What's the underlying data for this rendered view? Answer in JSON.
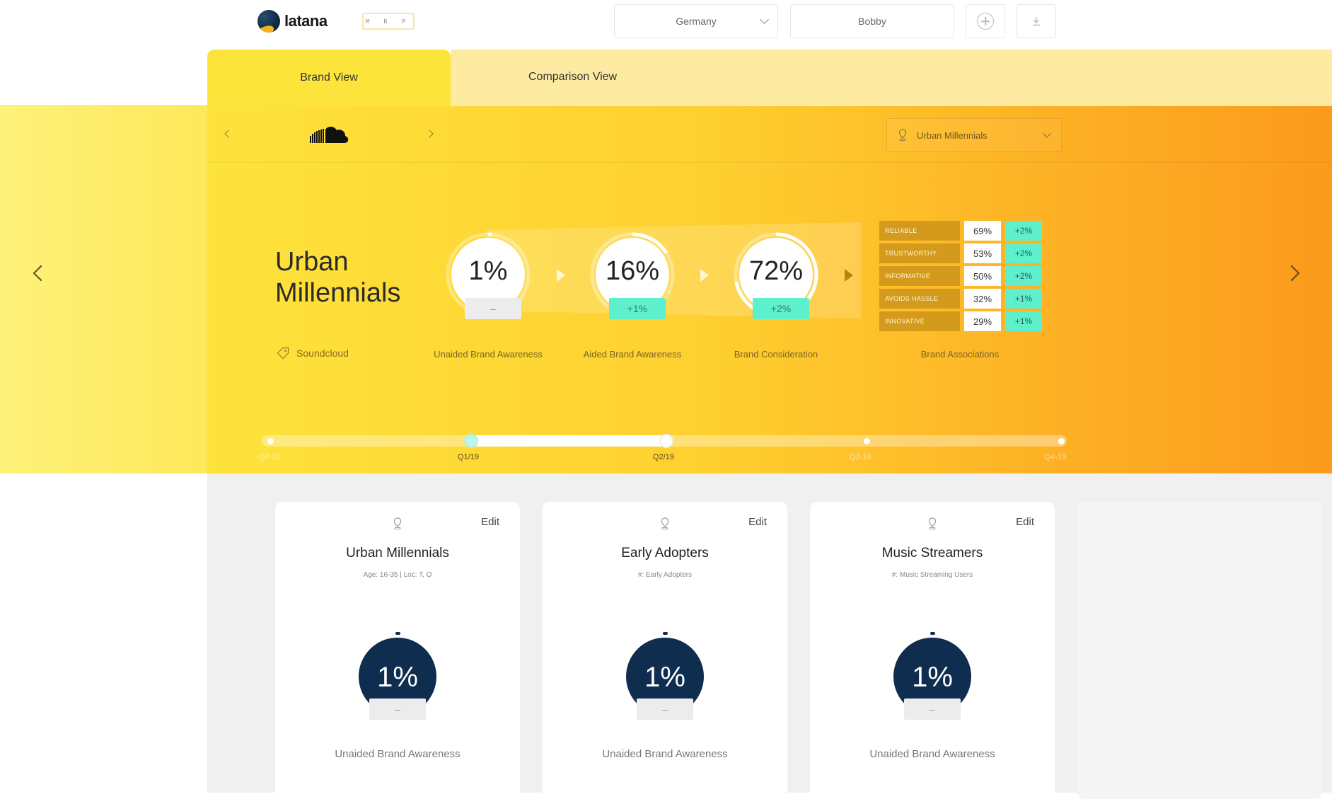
{
  "header": {
    "logo_text": "latana",
    "badge_text": "M R P",
    "country": "Germany",
    "user": "Bobby",
    "add_icon": "plus-circle-icon",
    "download_icon": "download-icon"
  },
  "tabs": [
    {
      "label": "Brand View",
      "active": true
    },
    {
      "label": "Comparison View",
      "active": false
    }
  ],
  "hero": {
    "brand_logo_icon": "soundcloud-logo",
    "segment_select": "Urban Millennials",
    "segment_title": "Urban Millennials",
    "brand_tag": "Soundcloud",
    "metrics": [
      {
        "value": "1%",
        "delta": "–",
        "label": "Unaided Brand Awareness",
        "fill": 0.01
      },
      {
        "value": "16%",
        "delta": "+1%",
        "label": "Aided Brand Awareness",
        "fill": 0.16
      },
      {
        "value": "72%",
        "delta": "+2%",
        "label": "Brand Consideration",
        "fill": 0.72
      }
    ],
    "associations_label": "Brand Associations",
    "associations": [
      {
        "label": "RELIABLE",
        "value": "69%",
        "delta": "+2%"
      },
      {
        "label": "TRUSTWORTHY",
        "value": "53%",
        "delta": "+2%"
      },
      {
        "label": "INFORMATIVE",
        "value": "50%",
        "delta": "+2%"
      },
      {
        "label": "AVOIDS HASSLE",
        "value": "32%",
        "delta": "+1%"
      },
      {
        "label": "INNOVATIVE",
        "value": "29%",
        "delta": "+1%"
      }
    ],
    "timeline": [
      {
        "label": "Q4-18",
        "selected": false
      },
      {
        "label": "Q1/19",
        "selected": true
      },
      {
        "label": "Q2/19",
        "selected": true
      },
      {
        "label": "Q3-19",
        "selected": false
      },
      {
        "label": "Q4-19",
        "selected": false
      }
    ]
  },
  "cards": [
    {
      "title": "Urban Millennials",
      "subtitle": "Age: 16-35 | Loc: T, O",
      "edit": "Edit",
      "value": "1%",
      "delta": "–",
      "label": "Unaided Brand Awareness"
    },
    {
      "title": "Early Adopters",
      "subtitle": "#: Early Adopters",
      "edit": "Edit",
      "value": "1%",
      "delta": "–",
      "label": "Unaided Brand Awareness"
    },
    {
      "title": "Music Streamers",
      "subtitle": "#: Music Streaming Users",
      "edit": "Edit",
      "value": "1%",
      "delta": "–",
      "label": "Unaided Brand Awareness"
    }
  ],
  "colors": {
    "accent_yellow": "#fde43a",
    "accent_orange": "#fc9a1c",
    "delta_positive": "#5ef0cc",
    "gauge_navy": "#0f2d4f"
  }
}
